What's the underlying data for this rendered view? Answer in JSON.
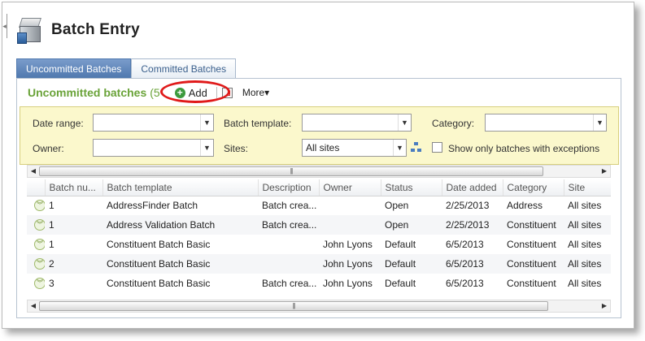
{
  "header": {
    "title": "Batch Entry",
    "icon": "batch-entry-icon"
  },
  "tabs": [
    {
      "label": "Uncommitted Batches",
      "active": true
    },
    {
      "label": "Committed Batches",
      "active": false
    }
  ],
  "toolbar": {
    "section_title": "Uncommitted batches",
    "count_text": "(5",
    "add_label": "Add",
    "more_label": "More▾"
  },
  "filters": {
    "date_range_label": "Date range:",
    "date_range_value": "",
    "batch_template_label": "Batch template:",
    "batch_template_value": "",
    "category_label": "Category:",
    "category_value": "",
    "owner_label": "Owner:",
    "owner_value": "",
    "sites_label": "Sites:",
    "sites_value": "All sites",
    "exceptions_label": "Show only batches with exceptions",
    "exceptions_checked": false
  },
  "grid": {
    "columns": [
      "",
      "Batch nu...",
      "Batch template",
      "Description",
      "Owner",
      "Status",
      "Date added",
      "Category",
      "Site"
    ],
    "rows": [
      {
        "number": "1",
        "template": "AddressFinder Batch",
        "description": "Batch crea...",
        "owner": "",
        "status": "Open",
        "date_added": "2/25/2013",
        "category": "Address",
        "site": "All sites"
      },
      {
        "number": "1",
        "template": "Address Validation Batch",
        "description": "Batch crea...",
        "owner": "",
        "status": "Open",
        "date_added": "2/25/2013",
        "category": "Constituent",
        "site": "All sites"
      },
      {
        "number": "1",
        "template": "Constituent Batch Basic",
        "description": "",
        "owner": "John Lyons",
        "status": "Default",
        "date_added": "6/5/2013",
        "category": "Constituent",
        "site": "All sites"
      },
      {
        "number": "2",
        "template": "Constituent Batch Basic",
        "description": "",
        "owner": "John Lyons",
        "status": "Default",
        "date_added": "6/5/2013",
        "category": "Constituent",
        "site": "All sites"
      },
      {
        "number": "3",
        "template": "Constituent Batch Basic",
        "description": "Batch crea...",
        "owner": "John Lyons",
        "status": "Default",
        "date_added": "6/5/2013",
        "category": "Constituent",
        "site": "All sites"
      }
    ]
  },
  "colors": {
    "section_title": "#6aa339",
    "active_tab": "#4f78ae",
    "filter_bg": "#fbf8cc",
    "highlight": "#e01a1a"
  }
}
